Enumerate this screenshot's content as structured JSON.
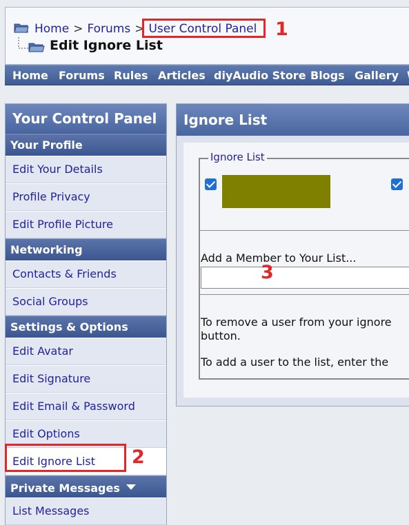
{
  "breadcrumb": {
    "home": "Home",
    "sep1": ">",
    "forums": "Forums",
    "sep2": ">",
    "ucp": "User Control Panel"
  },
  "page_title": "Edit Ignore List",
  "annotations": {
    "one": "1",
    "two": "2",
    "three": "3"
  },
  "topnav": [
    "Home",
    "Forums",
    "Rules",
    "Articles",
    "diyAudio Store",
    "Blogs",
    "Gallery",
    "W"
  ],
  "sidebar": {
    "title": "Your Control Panel",
    "sections": {
      "profile": "Your Profile",
      "networking": "Networking",
      "settings": "Settings & Options",
      "pm": "Private Messages"
    },
    "items": {
      "edit_details": "Edit Your Details",
      "profile_privacy": "Profile Privacy",
      "edit_profile_picture": "Edit Profile Picture",
      "contacts": "Contacts & Friends",
      "social_groups": "Social Groups",
      "edit_avatar": "Edit Avatar",
      "edit_signature": "Edit Signature",
      "edit_email": "Edit Email & Password",
      "edit_options": "Edit Options",
      "edit_ignore": "Edit Ignore List",
      "list_messages": "List Messages"
    }
  },
  "main": {
    "title": "Ignore List",
    "legend": "Ignore List",
    "add_label": "Add a Member to Your List...",
    "add_value": "",
    "help1_line1": "To remove a user from your ignore",
    "help1_line2": "button.",
    "help2": "To add a user to the list, enter the"
  },
  "colors": {
    "header_blue": "#4a66a0",
    "link": "#22229c",
    "annotation_red": "#e0282a",
    "redacted": "#7f7f00"
  }
}
